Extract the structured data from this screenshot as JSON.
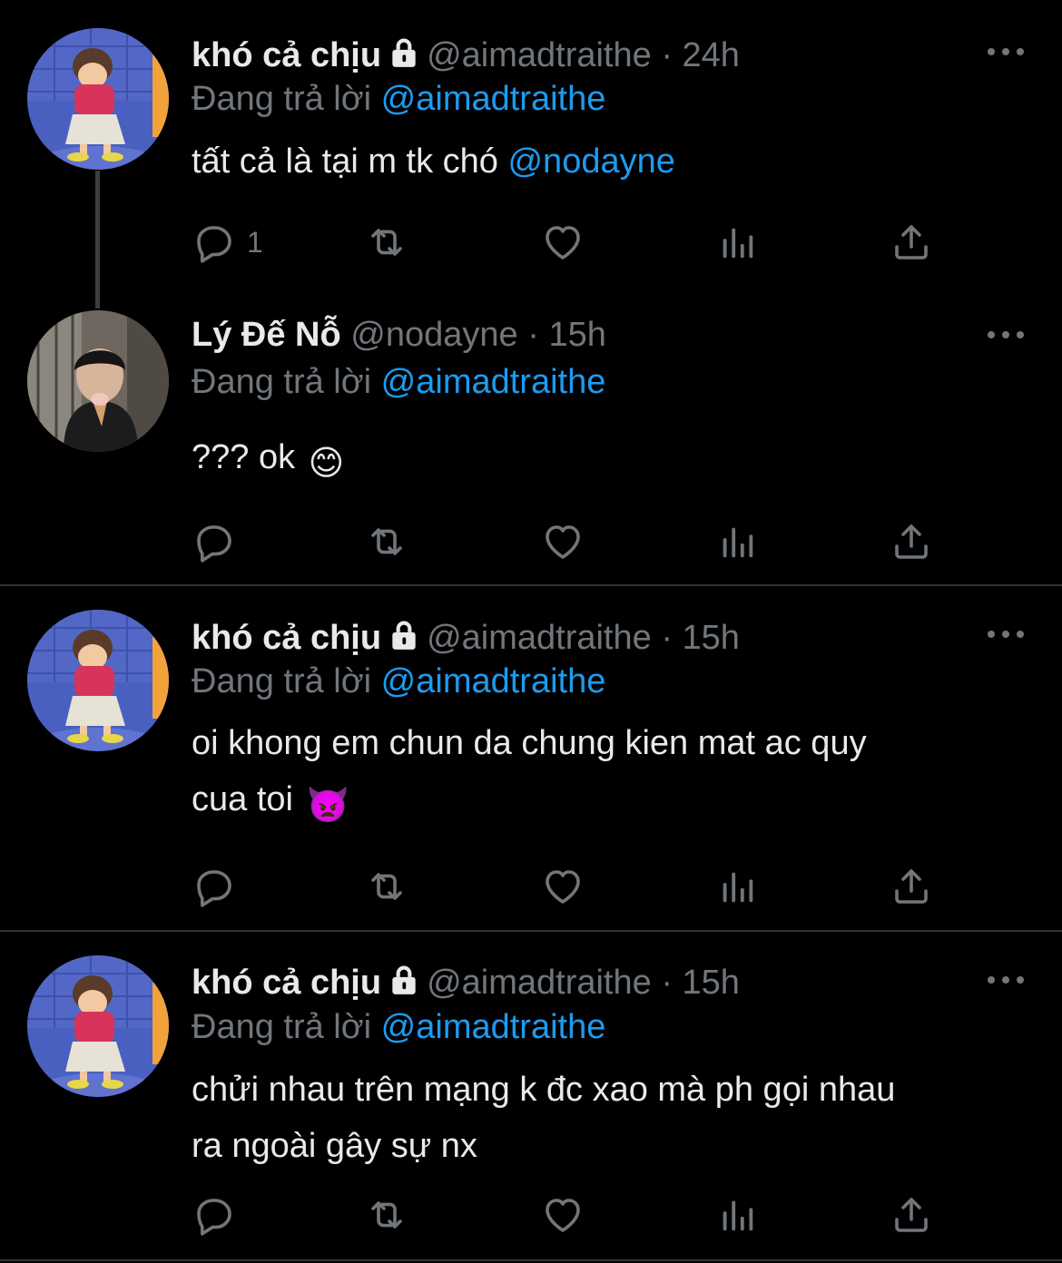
{
  "tweets": [
    {
      "name": "khó cả chịu",
      "handle": "@aimadtraithe",
      "sep": "·",
      "time": "24h",
      "replying_prefix": "Đang trả lời",
      "replying_to": "@aimadtraithe",
      "text": "tất cả là tại m tk chó",
      "mention": "@nodayne",
      "reply_count": "1"
    },
    {
      "name": "Lý Đế Nỗ",
      "handle": "@nodayne",
      "sep": "·",
      "time": "15h",
      "replying_prefix": "Đang trả lời",
      "replying_to": "@aimadtraithe",
      "text": "??? ok",
      "emoji": "😊",
      "reply_count": ""
    },
    {
      "name": "khó cả chịu",
      "handle": "@aimadtraithe",
      "sep": "·",
      "time": "15h",
      "replying_prefix": "Đang trả lời",
      "replying_to": "@aimadtraithe",
      "text_line1": "oi khong em chun da chung kien mat ac quy",
      "text_line2": "cua toi",
      "emoji": "👿",
      "reply_count": ""
    },
    {
      "name": "khó cả chịu",
      "handle": "@aimadtraithe",
      "sep": "·",
      "time": "15h",
      "replying_prefix": "Đang trả lời",
      "replying_to": "@aimadtraithe",
      "text_line1": "chửi nhau trên mạng k đc xao mà ph gọi nhau",
      "text_line2": "ra ngoài gây sự nx",
      "reply_count": ""
    }
  ],
  "icons": {
    "reply": "reply-icon",
    "retweet": "retweet-icon",
    "like": "heart-icon",
    "views": "analytics-icon",
    "share": "share-icon",
    "more": "more-options-icon",
    "lock": "lock-icon"
  },
  "colors": {
    "background": "#000000",
    "text": "#e7e9ea",
    "muted": "#71767b",
    "mention": "#1d9bf0",
    "divider": "#2f3336"
  }
}
